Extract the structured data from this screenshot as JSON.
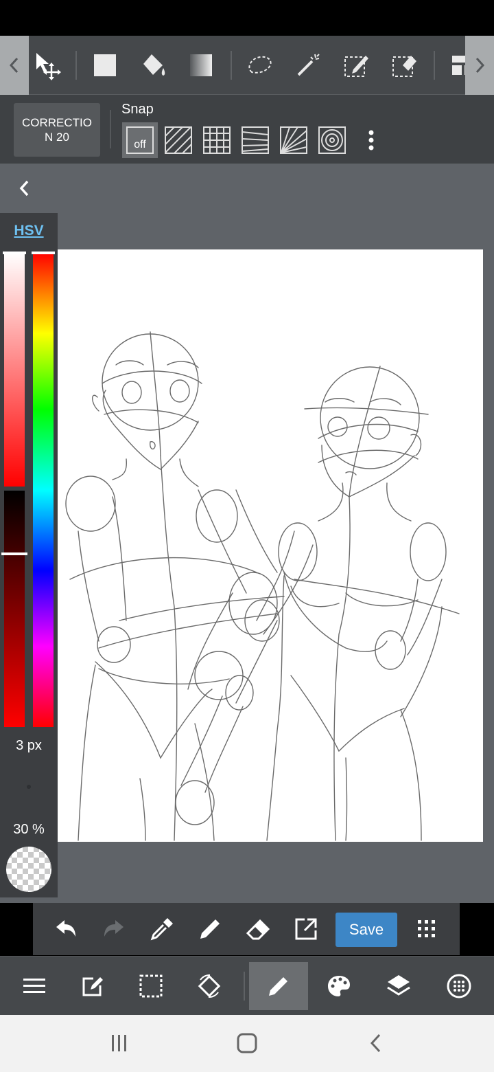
{
  "toolbar": {
    "tools": [
      {
        "name": "move-tool",
        "icon": "move-icon"
      },
      {
        "name": "fill-rect-tool",
        "icon": "rectangle-icon"
      },
      {
        "name": "bucket-tool",
        "icon": "bucket-icon"
      },
      {
        "name": "gradient-tool",
        "icon": "gradient-icon"
      },
      {
        "name": "lasso-tool",
        "icon": "lasso-icon"
      },
      {
        "name": "magic-wand-tool",
        "icon": "magic-wand-icon"
      },
      {
        "name": "select-pen-tool",
        "icon": "select-pen-icon"
      },
      {
        "name": "select-eraser-tool",
        "icon": "select-eraser-icon"
      },
      {
        "name": "frame-divider-tool",
        "icon": "frame-divider-icon"
      }
    ]
  },
  "sub_toolbar": {
    "correction_label": "CORRECTION 20",
    "snap_label": "Snap",
    "snap_off_label": "off",
    "snap_modes": [
      "off",
      "parallel",
      "grid",
      "perspective",
      "radial",
      "concentric"
    ]
  },
  "color_panel": {
    "mode_label": "HSV",
    "brush_size": "3 px",
    "opacity": "30 %",
    "hue_color": "#ff0000"
  },
  "action_bar": {
    "save_label": "Save",
    "buttons": [
      "undo",
      "redo",
      "eyedropper",
      "pen",
      "eraser",
      "export",
      "save",
      "grid-menu"
    ]
  },
  "bottom_toolbar": {
    "buttons": [
      "menu",
      "edit",
      "selection",
      "rotate",
      "brush",
      "palette",
      "layers",
      "brush-settings"
    ],
    "active": "brush"
  },
  "colors": {
    "toolbar_bg": "#45484b",
    "workspace_bg": "#5f6368",
    "accent": "#3d86c6",
    "hsv_label": "#6ec1f2"
  }
}
